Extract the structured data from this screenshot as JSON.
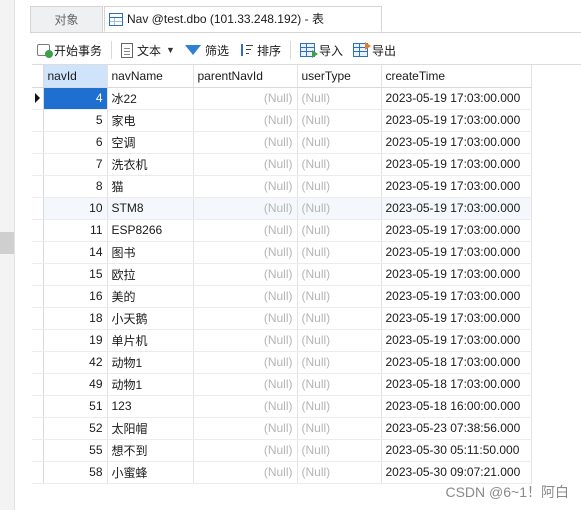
{
  "tabs": [
    {
      "label": "对象"
    },
    {
      "label": "Nav @test.dbo (101.33.248.192) - 表"
    }
  ],
  "toolbar": {
    "begin_transaction": "开始事务",
    "text": "文本",
    "filter": "筛选",
    "sort": "排序",
    "import": "导入",
    "export": "导出"
  },
  "table": {
    "columns": [
      "navId",
      "navName",
      "parentNavId",
      "userType",
      "createTime"
    ],
    "null_text": "(Null)",
    "rows": [
      {
        "navId": "4",
        "navName": "冰22",
        "createTime": "2023-05-19 17:03:00.000"
      },
      {
        "navId": "5",
        "navName": "家电",
        "createTime": "2023-05-19 17:03:00.000"
      },
      {
        "navId": "6",
        "navName": "空调",
        "createTime": "2023-05-19 17:03:00.000"
      },
      {
        "navId": "7",
        "navName": "洗衣机",
        "createTime": "2023-05-19 17:03:00.000"
      },
      {
        "navId": "8",
        "navName": "猫",
        "createTime": "2023-05-19 17:03:00.000"
      },
      {
        "navId": "10",
        "navName": "STM8",
        "createTime": "2023-05-19 17:03:00.000"
      },
      {
        "navId": "11",
        "navName": "ESP8266",
        "createTime": "2023-05-19 17:03:00.000"
      },
      {
        "navId": "14",
        "navName": "图书",
        "createTime": "2023-05-19 17:03:00.000"
      },
      {
        "navId": "15",
        "navName": "欧拉",
        "createTime": "2023-05-19 17:03:00.000"
      },
      {
        "navId": "16",
        "navName": "美的",
        "createTime": "2023-05-19 17:03:00.000"
      },
      {
        "navId": "18",
        "navName": "小天鹅",
        "createTime": "2023-05-19 17:03:00.000"
      },
      {
        "navId": "19",
        "navName": "单片机",
        "createTime": "2023-05-19 17:03:00.000"
      },
      {
        "navId": "42",
        "navName": "动物1",
        "createTime": "2023-05-18 17:03:00.000"
      },
      {
        "navId": "49",
        "navName": "动物1",
        "createTime": "2023-05-18 17:03:00.000"
      },
      {
        "navId": "51",
        "navName": "123",
        "createTime": "2023-05-18 16:00:00.000"
      },
      {
        "navId": "52",
        "navName": "太阳帽",
        "createTime": "2023-05-23 07:38:56.000"
      },
      {
        "navId": "55",
        "navName": "想不到",
        "createTime": "2023-05-30 05:11:50.000"
      },
      {
        "navId": "58",
        "navName": "小蜜蜂",
        "createTime": "2023-05-30 09:07:21.000"
      }
    ]
  },
  "watermark": "CSDN @6~1！阿白"
}
